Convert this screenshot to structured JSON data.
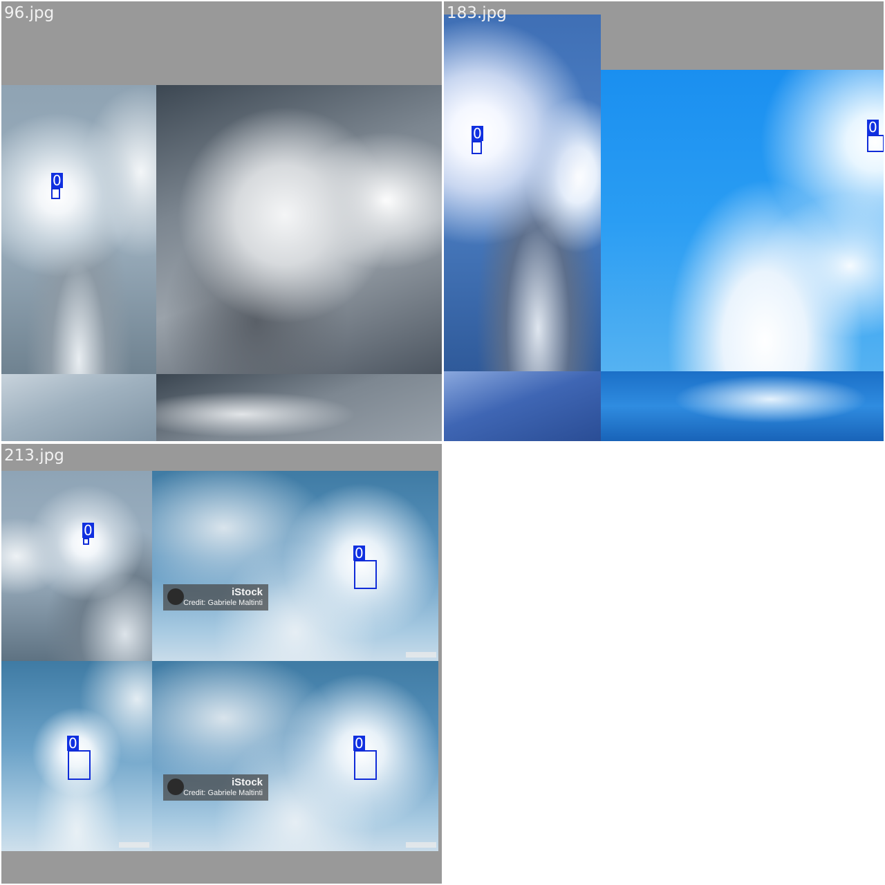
{
  "panels": [
    {
      "filename": "96.jpg",
      "class_label": "0"
    },
    {
      "filename": "183.jpg",
      "class_label": "0"
    },
    {
      "filename": "213.jpg",
      "class_label": "0"
    }
  ],
  "watermark": {
    "brand": "iStock",
    "credit": "Credit: Gabriele Maltinti"
  },
  "colors": {
    "panel_bg": "#999999",
    "box": "#0f2bd8",
    "label_bg": "#1030e0",
    "label_text": "#ffffff"
  }
}
